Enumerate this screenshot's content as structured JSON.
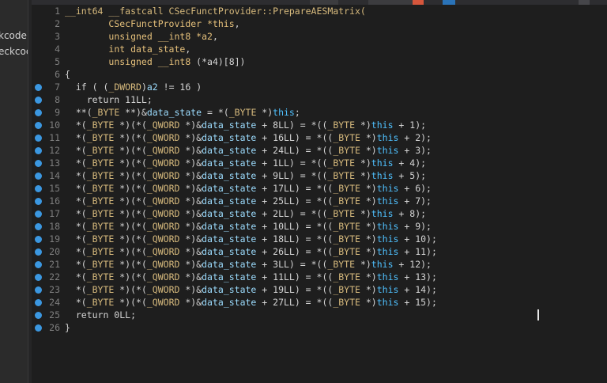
{
  "side_panel": {
    "items": [
      "kcode",
      "eckcoc"
    ]
  },
  "editor": {
    "lines": [
      {
        "n": "1",
        "bp": false,
        "tokens": [
          [
            "k",
            "__int64 __fastcall CSecFunctProvider::PrepareAESMatrix("
          ]
        ]
      },
      {
        "n": "2",
        "bp": false,
        "tokens": [
          [
            "p",
            "        "
          ],
          [
            "t",
            "CSecFunctProvider *this"
          ],
          [
            "p",
            ","
          ]
        ]
      },
      {
        "n": "3",
        "bp": false,
        "tokens": [
          [
            "p",
            "        "
          ],
          [
            "t",
            "unsigned __int8 *a2"
          ],
          [
            "p",
            ","
          ]
        ]
      },
      {
        "n": "4",
        "bp": false,
        "tokens": [
          [
            "p",
            "        "
          ],
          [
            "t",
            "int data_state"
          ],
          [
            "p",
            ","
          ]
        ]
      },
      {
        "n": "5",
        "bp": false,
        "tokens": [
          [
            "p",
            "        "
          ],
          [
            "t",
            "unsigned __int8 "
          ],
          [
            "p",
            "(*a4)[8])"
          ]
        ]
      },
      {
        "n": "6",
        "bp": false,
        "tokens": [
          [
            "p",
            "{"
          ]
        ]
      },
      {
        "n": "7",
        "bp": true,
        "tokens": [
          [
            "p",
            "  if ( ("
          ],
          [
            "k",
            "_DWORD"
          ],
          [
            "p",
            ")"
          ],
          [
            "v",
            "a2"
          ],
          [
            "p",
            " != 16 )"
          ]
        ]
      },
      {
        "n": "8",
        "bp": true,
        "tokens": [
          [
            "r",
            "    return 11LL;"
          ]
        ]
      },
      {
        "n": "9",
        "bp": true,
        "tokens": [
          [
            "p",
            "  **("
          ],
          [
            "k",
            "_BYTE"
          ],
          [
            "p",
            " **)&"
          ],
          [
            "v",
            "data_state"
          ],
          [
            "p",
            " = *("
          ],
          [
            "k",
            "_BYTE"
          ],
          [
            "p",
            " *)"
          ],
          [
            "th",
            "this"
          ],
          [
            "p",
            ";"
          ]
        ]
      },
      {
        "n": "10",
        "bp": true,
        "tokens": [
          [
            "p",
            "  *("
          ],
          [
            "k",
            "_BYTE"
          ],
          [
            "p",
            " *)(*("
          ],
          [
            "k",
            "_QWORD"
          ],
          [
            "p",
            " *)&"
          ],
          [
            "v",
            "data_state"
          ],
          [
            "p",
            " + 8LL) = *(("
          ],
          [
            "k",
            "_BYTE"
          ],
          [
            "p",
            " *)"
          ],
          [
            "th",
            "this"
          ],
          [
            "p",
            " + 1);"
          ]
        ]
      },
      {
        "n": "11",
        "bp": true,
        "tokens": [
          [
            "p",
            "  *("
          ],
          [
            "k",
            "_BYTE"
          ],
          [
            "p",
            " *)(*("
          ],
          [
            "k",
            "_QWORD"
          ],
          [
            "p",
            " *)&"
          ],
          [
            "v",
            "data_state"
          ],
          [
            "p",
            " + 16LL) = *(("
          ],
          [
            "k",
            "_BYTE"
          ],
          [
            "p",
            " *)"
          ],
          [
            "th",
            "this"
          ],
          [
            "p",
            " + 2);"
          ]
        ]
      },
      {
        "n": "12",
        "bp": true,
        "tokens": [
          [
            "p",
            "  *("
          ],
          [
            "k",
            "_BYTE"
          ],
          [
            "p",
            " *)(*("
          ],
          [
            "k",
            "_QWORD"
          ],
          [
            "p",
            " *)&"
          ],
          [
            "v",
            "data_state"
          ],
          [
            "p",
            " + 24LL) = *(("
          ],
          [
            "k",
            "_BYTE"
          ],
          [
            "p",
            " *)"
          ],
          [
            "th",
            "this"
          ],
          [
            "p",
            " + 3);"
          ]
        ]
      },
      {
        "n": "13",
        "bp": true,
        "tokens": [
          [
            "p",
            "  *("
          ],
          [
            "k",
            "_BYTE"
          ],
          [
            "p",
            " *)(*("
          ],
          [
            "k",
            "_QWORD"
          ],
          [
            "p",
            " *)&"
          ],
          [
            "v",
            "data_state"
          ],
          [
            "p",
            " + 1LL) = *(("
          ],
          [
            "k",
            "_BYTE"
          ],
          [
            "p",
            " *)"
          ],
          [
            "th",
            "this"
          ],
          [
            "p",
            " + 4);"
          ]
        ]
      },
      {
        "n": "14",
        "bp": true,
        "tokens": [
          [
            "p",
            "  *("
          ],
          [
            "k",
            "_BYTE"
          ],
          [
            "p",
            " *)(*("
          ],
          [
            "k",
            "_QWORD"
          ],
          [
            "p",
            " *)&"
          ],
          [
            "v",
            "data_state"
          ],
          [
            "p",
            " + 9LL) = *(("
          ],
          [
            "k",
            "_BYTE"
          ],
          [
            "p",
            " *)"
          ],
          [
            "th",
            "this"
          ],
          [
            "p",
            " + 5);"
          ]
        ]
      },
      {
        "n": "15",
        "bp": true,
        "tokens": [
          [
            "p",
            "  *("
          ],
          [
            "k",
            "_BYTE"
          ],
          [
            "p",
            " *)(*("
          ],
          [
            "k",
            "_QWORD"
          ],
          [
            "p",
            " *)&"
          ],
          [
            "v",
            "data_state"
          ],
          [
            "p",
            " + 17LL) = *(("
          ],
          [
            "k",
            "_BYTE"
          ],
          [
            "p",
            " *)"
          ],
          [
            "th",
            "this"
          ],
          [
            "p",
            " + 6);"
          ]
        ]
      },
      {
        "n": "16",
        "bp": true,
        "tokens": [
          [
            "p",
            "  *("
          ],
          [
            "k",
            "_BYTE"
          ],
          [
            "p",
            " *)(*("
          ],
          [
            "k",
            "_QWORD"
          ],
          [
            "p",
            " *)&"
          ],
          [
            "v",
            "data_state"
          ],
          [
            "p",
            " + 25LL) = *(("
          ],
          [
            "k",
            "_BYTE"
          ],
          [
            "p",
            " *)"
          ],
          [
            "th",
            "this"
          ],
          [
            "p",
            " + 7);"
          ]
        ]
      },
      {
        "n": "17",
        "bp": true,
        "tokens": [
          [
            "p",
            "  *("
          ],
          [
            "k",
            "_BYTE"
          ],
          [
            "p",
            " *)(*("
          ],
          [
            "k",
            "_QWORD"
          ],
          [
            "p",
            " *)&"
          ],
          [
            "v",
            "data_state"
          ],
          [
            "p",
            " + 2LL) = *(("
          ],
          [
            "k",
            "_BYTE"
          ],
          [
            "p",
            " *)"
          ],
          [
            "th",
            "this"
          ],
          [
            "p",
            " + 8);"
          ]
        ]
      },
      {
        "n": "18",
        "bp": true,
        "tokens": [
          [
            "p",
            "  *("
          ],
          [
            "k",
            "_BYTE"
          ],
          [
            "p",
            " *)(*("
          ],
          [
            "k",
            "_QWORD"
          ],
          [
            "p",
            " *)&"
          ],
          [
            "v",
            "data_state"
          ],
          [
            "p",
            " + 10LL) = *(("
          ],
          [
            "k",
            "_BYTE"
          ],
          [
            "p",
            " *)"
          ],
          [
            "th",
            "this"
          ],
          [
            "p",
            " + 9);"
          ]
        ]
      },
      {
        "n": "19",
        "bp": true,
        "tokens": [
          [
            "p",
            "  *("
          ],
          [
            "k",
            "_BYTE"
          ],
          [
            "p",
            " *)(*("
          ],
          [
            "k",
            "_QWORD"
          ],
          [
            "p",
            " *)&"
          ],
          [
            "v",
            "data_state"
          ],
          [
            "p",
            " + 18LL) = *(("
          ],
          [
            "k",
            "_BYTE"
          ],
          [
            "p",
            " *)"
          ],
          [
            "th",
            "this"
          ],
          [
            "p",
            " + 10);"
          ]
        ]
      },
      {
        "n": "20",
        "bp": true,
        "tokens": [
          [
            "p",
            "  *("
          ],
          [
            "k",
            "_BYTE"
          ],
          [
            "p",
            " *)(*("
          ],
          [
            "k",
            "_QWORD"
          ],
          [
            "p",
            " *)&"
          ],
          [
            "v",
            "data_state"
          ],
          [
            "p",
            " + 26LL) = *(("
          ],
          [
            "k",
            "_BYTE"
          ],
          [
            "p",
            " *)"
          ],
          [
            "th",
            "this"
          ],
          [
            "p",
            " + 11);"
          ]
        ]
      },
      {
        "n": "21",
        "bp": true,
        "tokens": [
          [
            "p",
            "  *("
          ],
          [
            "k",
            "_BYTE"
          ],
          [
            "p",
            " *)(*("
          ],
          [
            "k",
            "_QWORD"
          ],
          [
            "p",
            " *)&"
          ],
          [
            "v",
            "data_state"
          ],
          [
            "p",
            " + 3LL) = *(("
          ],
          [
            "k",
            "_BYTE"
          ],
          [
            "p",
            " *)"
          ],
          [
            "th",
            "this"
          ],
          [
            "p",
            " + 12);"
          ]
        ]
      },
      {
        "n": "22",
        "bp": true,
        "tokens": [
          [
            "p",
            "  *("
          ],
          [
            "k",
            "_BYTE"
          ],
          [
            "p",
            " *)(*("
          ],
          [
            "k",
            "_QWORD"
          ],
          [
            "p",
            " *)&"
          ],
          [
            "v",
            "data_state"
          ],
          [
            "p",
            " + 11LL) = *(("
          ],
          [
            "k",
            "_BYTE"
          ],
          [
            "p",
            " *)"
          ],
          [
            "th",
            "this"
          ],
          [
            "p",
            " + 13);"
          ]
        ]
      },
      {
        "n": "23",
        "bp": true,
        "tokens": [
          [
            "p",
            "  *("
          ],
          [
            "k",
            "_BYTE"
          ],
          [
            "p",
            " *)(*("
          ],
          [
            "k",
            "_QWORD"
          ],
          [
            "p",
            " *)&"
          ],
          [
            "v",
            "data_state"
          ],
          [
            "p",
            " + 19LL) = *(("
          ],
          [
            "k",
            "_BYTE"
          ],
          [
            "p",
            " *)"
          ],
          [
            "th",
            "this"
          ],
          [
            "p",
            " + 14);"
          ]
        ]
      },
      {
        "n": "24",
        "bp": true,
        "tokens": [
          [
            "p",
            "  *("
          ],
          [
            "k",
            "_BYTE"
          ],
          [
            "p",
            " *)(*("
          ],
          [
            "k",
            "_QWORD"
          ],
          [
            "p",
            " *)&"
          ],
          [
            "v",
            "data_state"
          ],
          [
            "p",
            " + 27LL) = *(("
          ],
          [
            "k",
            "_BYTE"
          ],
          [
            "p",
            " *)"
          ],
          [
            "th",
            "this"
          ],
          [
            "p",
            " + 15);"
          ]
        ]
      },
      {
        "n": "25",
        "bp": true,
        "tokens": [
          [
            "r",
            "  return 0LL;"
          ]
        ]
      },
      {
        "n": "26",
        "bp": true,
        "tokens": [
          [
            "p",
            "}"
          ]
        ]
      }
    ]
  },
  "colors": {
    "background": "#1e1e1e",
    "breakpoint": "#3b97e0",
    "line_number": "#7e7e7e",
    "type": "#e5c07b",
    "variable": "#9cdcfe",
    "this_keyword": "#4fc1ff"
  }
}
